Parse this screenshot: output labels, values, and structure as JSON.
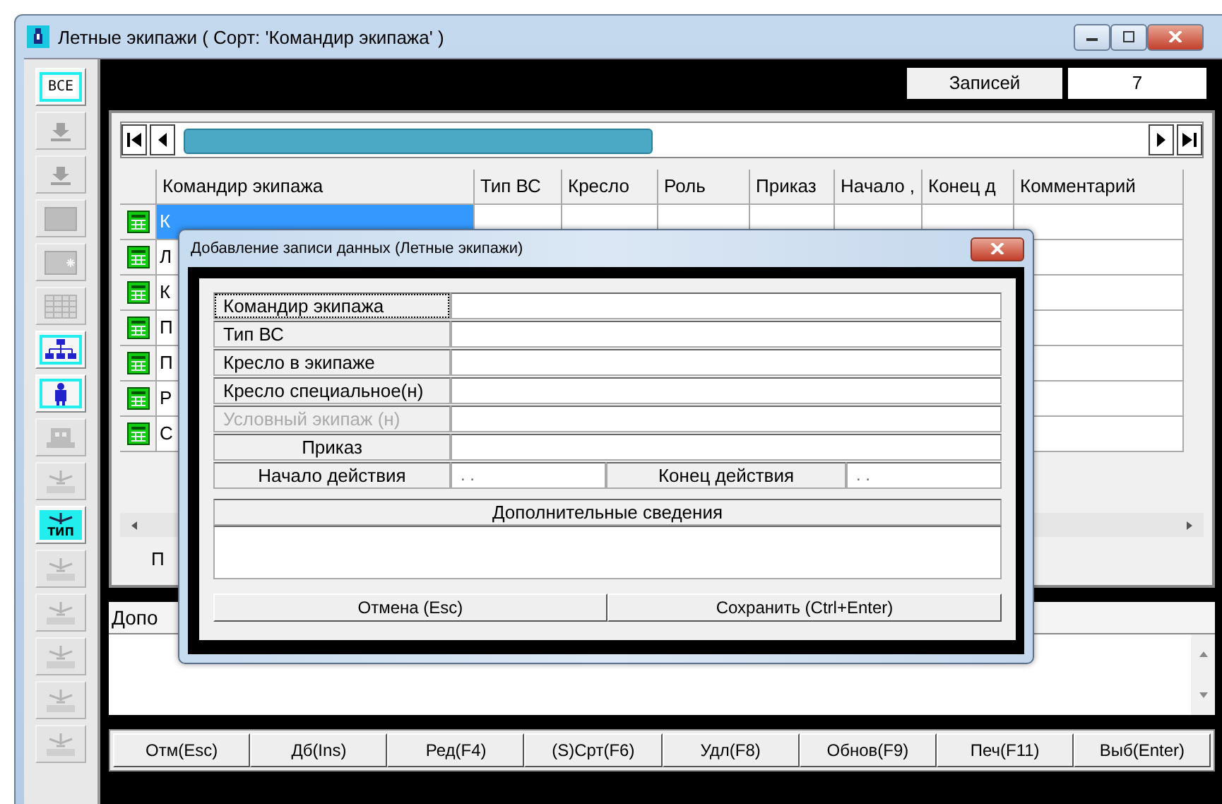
{
  "window": {
    "title": "Летные экипажи ( Сорт: 'Командир экипажа' )"
  },
  "toolbar": [
    {
      "kind": "text",
      "label": "ВСЕ",
      "disabled": false
    },
    {
      "kind": "download",
      "disabled": true
    },
    {
      "kind": "download",
      "disabled": true
    },
    {
      "kind": "blank",
      "disabled": true
    },
    {
      "kind": "star-card",
      "disabled": true
    },
    {
      "kind": "grid",
      "disabled": true
    },
    {
      "kind": "tree",
      "disabled": false
    },
    {
      "kind": "person",
      "disabled": false
    },
    {
      "kind": "robot",
      "disabled": true
    },
    {
      "kind": "plane",
      "disabled": true
    },
    {
      "kind": "plane-label",
      "label": "ТИП",
      "disabled": false
    },
    {
      "kind": "plane",
      "disabled": true
    },
    {
      "kind": "plane",
      "disabled": true
    },
    {
      "kind": "plane",
      "disabled": true
    },
    {
      "kind": "plane",
      "disabled": true
    },
    {
      "kind": "plane",
      "disabled": true
    }
  ],
  "counter": {
    "label": "Записей",
    "value": "7"
  },
  "table": {
    "columns": [
      "Командир экипажа",
      "Тип ВС",
      "Кресло",
      "Роль",
      "Приказ",
      "Начало ,",
      "Конец д",
      "Комментарий"
    ],
    "rows": [
      {
        "column_1": "К",
        "selected": true
      },
      {
        "column_1": "Л",
        "selected": false
      },
      {
        "column_1": "К",
        "selected": false
      },
      {
        "column_1": "П",
        "selected": false
      },
      {
        "column_1": "П",
        "selected": false
      },
      {
        "column_1": "Р",
        "selected": false
      },
      {
        "column_1": "С",
        "selected": false
      }
    ]
  },
  "tab_label": "П",
  "details_panel": {
    "label": "Допо"
  },
  "buttons": [
    "Отм(Esc)",
    "Дб(Ins)",
    "Ред(F4)",
    "(S)Срт(F6)",
    "Удл(F8)",
    "Обнов(F9)",
    "Печ(F11)",
    "Выб(Enter)"
  ],
  "dialog": {
    "title": "Добавление записи данных  (Летные экипажи)",
    "fields": [
      {
        "label": "Командир  экипажа",
        "kind": "plain",
        "focused": true,
        "disabled": false
      },
      {
        "label": "Тип ВС",
        "kind": "plain",
        "focused": false,
        "disabled": false
      },
      {
        "label": "Кресло в экипаже",
        "kind": "plain",
        "focused": false,
        "disabled": false
      },
      {
        "label": "Кресло специальное(н)",
        "kind": "plain",
        "focused": false,
        "disabled": false
      },
      {
        "label": "Условный экипаж     (н)",
        "kind": "plain",
        "focused": false,
        "disabled": true
      },
      {
        "label": "Приказ",
        "kind": "centered",
        "focused": false,
        "disabled": false
      }
    ],
    "dates": [
      {
        "label": "Начало действия",
        "value": ". ."
      },
      {
        "label": "Конец действия",
        "value": ". ."
      }
    ],
    "notes_header": "Дополнительные  сведения",
    "buttons": [
      "Отмена (Esc)",
      "Сохранить (Ctrl+Enter)"
    ]
  }
}
